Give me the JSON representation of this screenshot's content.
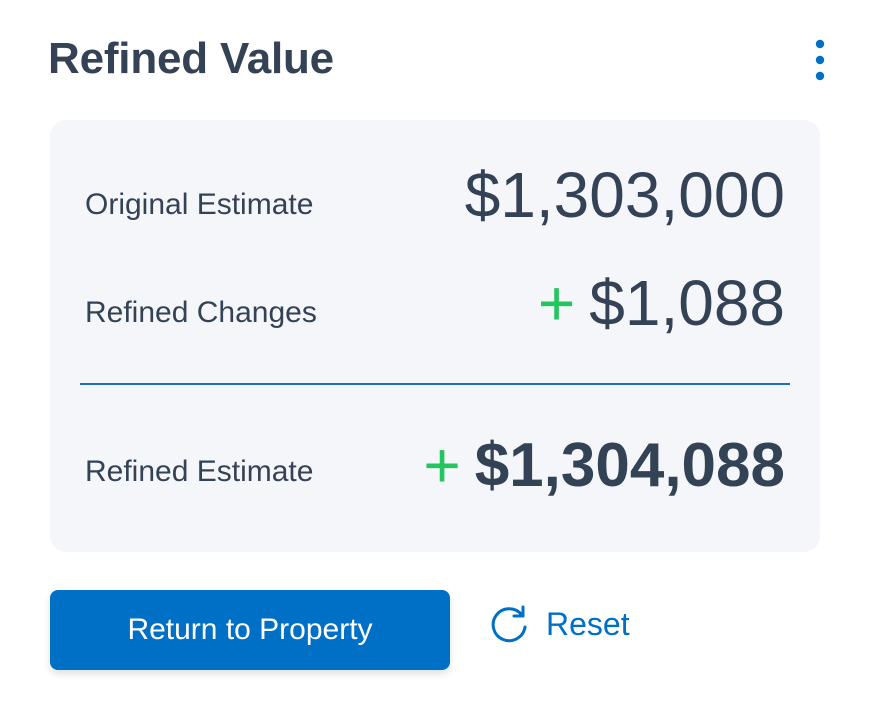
{
  "header": {
    "title": "Refined Value",
    "menu_icon": "more-vertical-icon"
  },
  "summary": {
    "original_estimate": {
      "label": "Original Estimate",
      "value": "$1,303,000"
    },
    "refined_changes": {
      "label": "Refined Changes",
      "sign": "+",
      "value": "$1,088"
    },
    "refined_estimate": {
      "label": "Refined Estimate",
      "sign": "+",
      "value": "$1,304,088"
    }
  },
  "actions": {
    "primary_label": "Return to Property",
    "reset_label": "Reset",
    "reset_icon": "refresh-icon"
  },
  "colors": {
    "primary": "#0070c6",
    "positive": "#22c55e",
    "text": "#344256",
    "card_background": "#f4f6fa"
  }
}
